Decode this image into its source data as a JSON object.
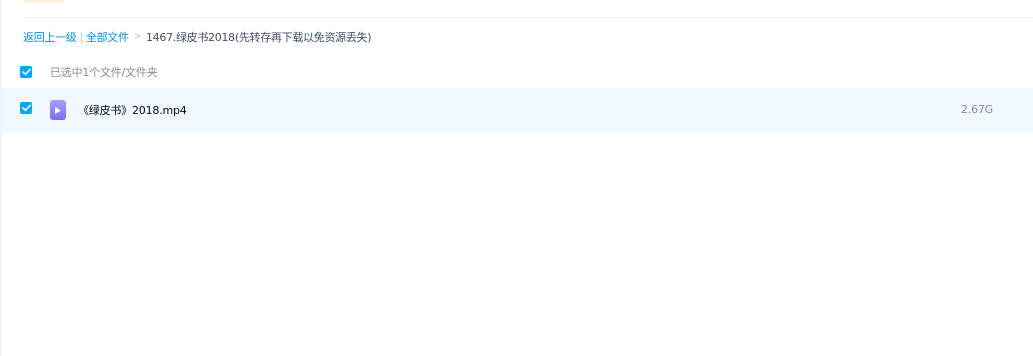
{
  "breadcrumb": {
    "back_label": "返回上一级",
    "separator": "|",
    "all_files_label": "全部文件",
    "arrow": ">",
    "current_folder": "1467.绿皮书2018(先转存再下载以免资源丢失)"
  },
  "selection": {
    "summary": "已选中1个文件/文件夹",
    "checked": true
  },
  "files": [
    {
      "name": "《绿皮书》2018.mp4",
      "size": "2.67G",
      "type_icon": "video-file-icon",
      "checked": true
    }
  ],
  "colors": {
    "link": "#0e8ee0",
    "checkbox": "#06a7ff",
    "row_selected_bg": "#f1f9ff",
    "video_icon": "#8c7cf8"
  }
}
